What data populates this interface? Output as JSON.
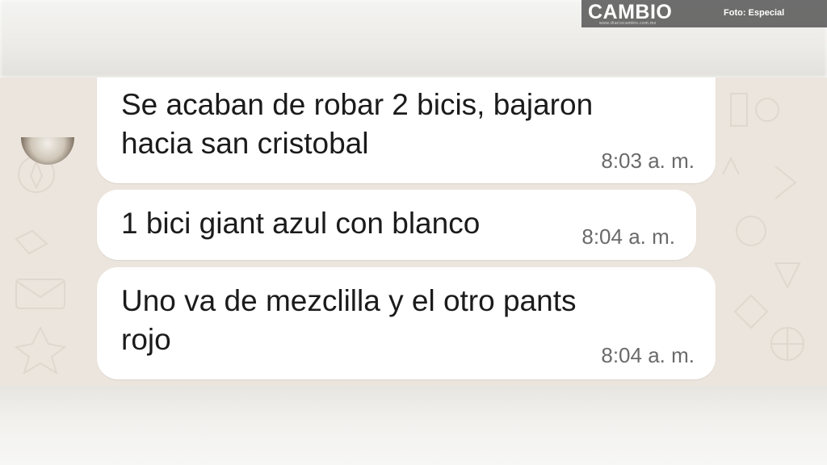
{
  "watermark": {
    "brand": "CAMBIO",
    "site": "www.diariocambio.com.mx",
    "photo_credit": "Foto: Especial"
  },
  "chat": {
    "background_color": "#ece5dd",
    "bubble_color": "#ffffff",
    "messages": [
      {
        "lines": [
          "Se acaban de robar 2 bicis, bajaron",
          "hacia san cristobal"
        ],
        "time": "8:03 a. m."
      },
      {
        "lines": [
          "1 bici giant azul con blanco"
        ],
        "time": "8:04 a. m."
      },
      {
        "lines": [
          "Uno va de mezclilla y el otro pants",
          "rojo"
        ],
        "time": "8:04 a. m."
      }
    ]
  },
  "avatar": {
    "icon": "contact-avatar"
  }
}
